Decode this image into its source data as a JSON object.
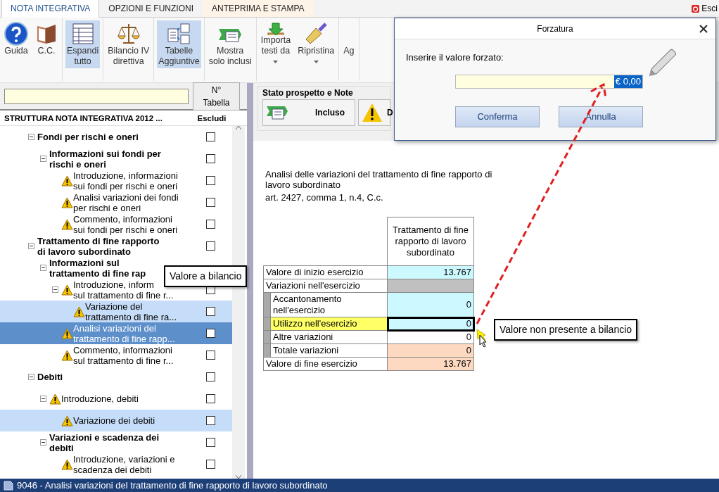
{
  "ribbon_tabs": [
    {
      "label": "NOTA INTEGRATIVA",
      "selected": true,
      "kind": "normal"
    },
    {
      "label": "OPZIONI E FUNZIONI",
      "selected": false,
      "kind": "normal"
    },
    {
      "label": "ANTEPRIMA E STAMPA",
      "selected": false,
      "kind": "context"
    }
  ],
  "exit": {
    "label": "Esci"
  },
  "toolbar": [
    {
      "label": "Guida",
      "kind": "help",
      "active": false,
      "dropdown": false
    },
    {
      "label": "C.C.",
      "kind": "book",
      "active": false,
      "dropdown": false
    },
    {
      "label": "Espandi\ntutto",
      "kind": "expand",
      "active": true,
      "dropdown": false
    },
    {
      "label": "Bilancio IV\ndirettiva",
      "kind": "scales",
      "active": false,
      "dropdown": false
    },
    {
      "label": "Tabelle\nAggiuntive",
      "kind": "tables",
      "active": true,
      "dropdown": false
    },
    {
      "label": "Mostra\nsolo inclusi",
      "kind": "show",
      "active": false,
      "dropdown": false
    },
    {
      "label": "Importa\ntesti da",
      "kind": "import",
      "active": false,
      "dropdown": true
    },
    {
      "label": "Ripristina",
      "kind": "brush",
      "active": false,
      "dropdown": true
    },
    {
      "label": "Ag",
      "kind": "none"
    }
  ],
  "search": {
    "button": "N° Tabella"
  },
  "tree": {
    "columns": [
      "STRUTTURA NOTA INTEGRATIVA 2012 ...",
      "Escludi"
    ],
    "items": [
      {
        "label": "Fondi per rischi e oneri",
        "kind": "group",
        "expanded": true,
        "selected": false,
        "highlighted": false,
        "checked": false,
        "children": [
          {
            "label": "Informazioni sui fondi per\nrischi e oneri",
            "kind": "group",
            "expanded": true,
            "selected": false,
            "highlighted": false,
            "checked": false,
            "children": [
              {
                "label": "Introduzione, informazioni\nsui fondi per rischi e oneri",
                "kind": "item",
                "selected": false,
                "highlighted": false,
                "checked": false
              },
              {
                "label": "Analisi variazioni dei fondi\nper rischi e oneri",
                "kind": "item",
                "selected": false,
                "highlighted": false,
                "checked": false
              },
              {
                "label": "Commento, informazioni\nsui fondi per rischi e oneri",
                "kind": "item",
                "selected": false,
                "highlighted": false,
                "checked": false
              }
            ]
          }
        ]
      },
      {
        "label": "Trattamento di fine rapporto\ndi lavoro subordinato",
        "kind": "group",
        "expanded": true,
        "selected": false,
        "highlighted": false,
        "checked": false,
        "children": [
          {
            "label": "Informazioni sul\ntrattamento di fine rap",
            "kind": "group",
            "expanded": true,
            "selected": false,
            "highlighted": false,
            "children": [
              {
                "label": "Introduzione, inform\nsul trattamento di fine r...",
                "kind": "item",
                "expanded": true,
                "selected": false,
                "highlighted": false,
                "checked": false,
                "children": [
                  {
                    "label": "Variazione del\ntrattamento di fine ra...",
                    "kind": "item",
                    "selected": false,
                    "highlighted": true,
                    "checked": false
                  }
                ]
              },
              {
                "label": "Analisi variazioni del\ntrattamento di fine rapp...",
                "kind": "item",
                "selected": true,
                "highlighted": false,
                "checked": false
              },
              {
                "label": "Commento, informazioni\nsul trattamento di fine r...",
                "kind": "item",
                "selected": false,
                "highlighted": false,
                "checked": false
              }
            ]
          }
        ]
      },
      {
        "label": "Debiti",
        "kind": "group",
        "expanded": true,
        "selected": false,
        "highlighted": false,
        "checked": false,
        "children": [
          {
            "label": "Introduzione, debiti",
            "kind": "item",
            "expanded": true,
            "selected": false,
            "highlighted": false,
            "checked": false,
            "children": [
              {
                "label": "Variazione dei debiti",
                "kind": "item",
                "selected": false,
                "highlighted": true,
                "checked": false
              }
            ]
          },
          {
            "label": "Variazioni e scadenza dei\ndebiti",
            "kind": "group",
            "expanded": true,
            "selected": false,
            "highlighted": false,
            "checked": false,
            "children": [
              {
                "label": "Introduzione, variazioni e\nscadenza dei debiti",
                "kind": "item",
                "selected": false,
                "highlighted": false,
                "checked": false
              }
            ]
          }
        ]
      }
    ]
  },
  "status_panel": {
    "title": "Stato prospetto e Note",
    "buttons": [
      {
        "label": "Incluso",
        "kind": "included"
      },
      {
        "label": "D",
        "kind": "warning"
      }
    ]
  },
  "description": {
    "title": "Analisi delle variazioni del trattamento di fine rapporto di lavoro subordinato",
    "reference": "art. 2427, comma 1, n.4, C.c."
  },
  "table": {
    "column": "Trattamento di fine rapporto di lavoro subordinato",
    "rows": [
      {
        "label": "Valore di inizio esercizio",
        "kind": "main",
        "value": "13.767",
        "color": "#ccf8ff",
        "highlighted": false
      },
      {
        "label": "Variazioni nell'esercizio",
        "kind": "main",
        "value": "",
        "color": "#c0c0c0",
        "highlighted": false
      },
      {
        "label": "Accantonamento nell'esercizio",
        "kind": "sub",
        "value": "0",
        "color": "#ccf8ff",
        "highlighted": false
      },
      {
        "label": "Utilizzo nell'esercizio",
        "kind": "sub",
        "value": "0",
        "color": "#ccf8ff",
        "highlighted": true
      },
      {
        "label": "Altre variazioni",
        "kind": "sub",
        "value": "0",
        "color": "#ffffff",
        "highlighted": false
      },
      {
        "label": "Totale variazioni",
        "kind": "sub",
        "value": "0",
        "color": "#fcd9c0",
        "highlighted": false
      },
      {
        "label": "Valore di fine esercizio",
        "kind": "main",
        "value": "13.767",
        "color": "#fcd9c0",
        "highlighted": false
      }
    ]
  },
  "callouts": [
    "Valore a bilancio",
    "Valore non presente a bilancio"
  ],
  "dialog": {
    "title": "Forzatura",
    "label": "Inserire il valore forzato:",
    "value": "€ 0,00",
    "buttons": [
      "Conferma",
      "Annulla"
    ]
  },
  "status_bar": {
    "text": "9046 - Analisi variazioni del trattamento di fine rapporto di lavoro subordinato"
  }
}
